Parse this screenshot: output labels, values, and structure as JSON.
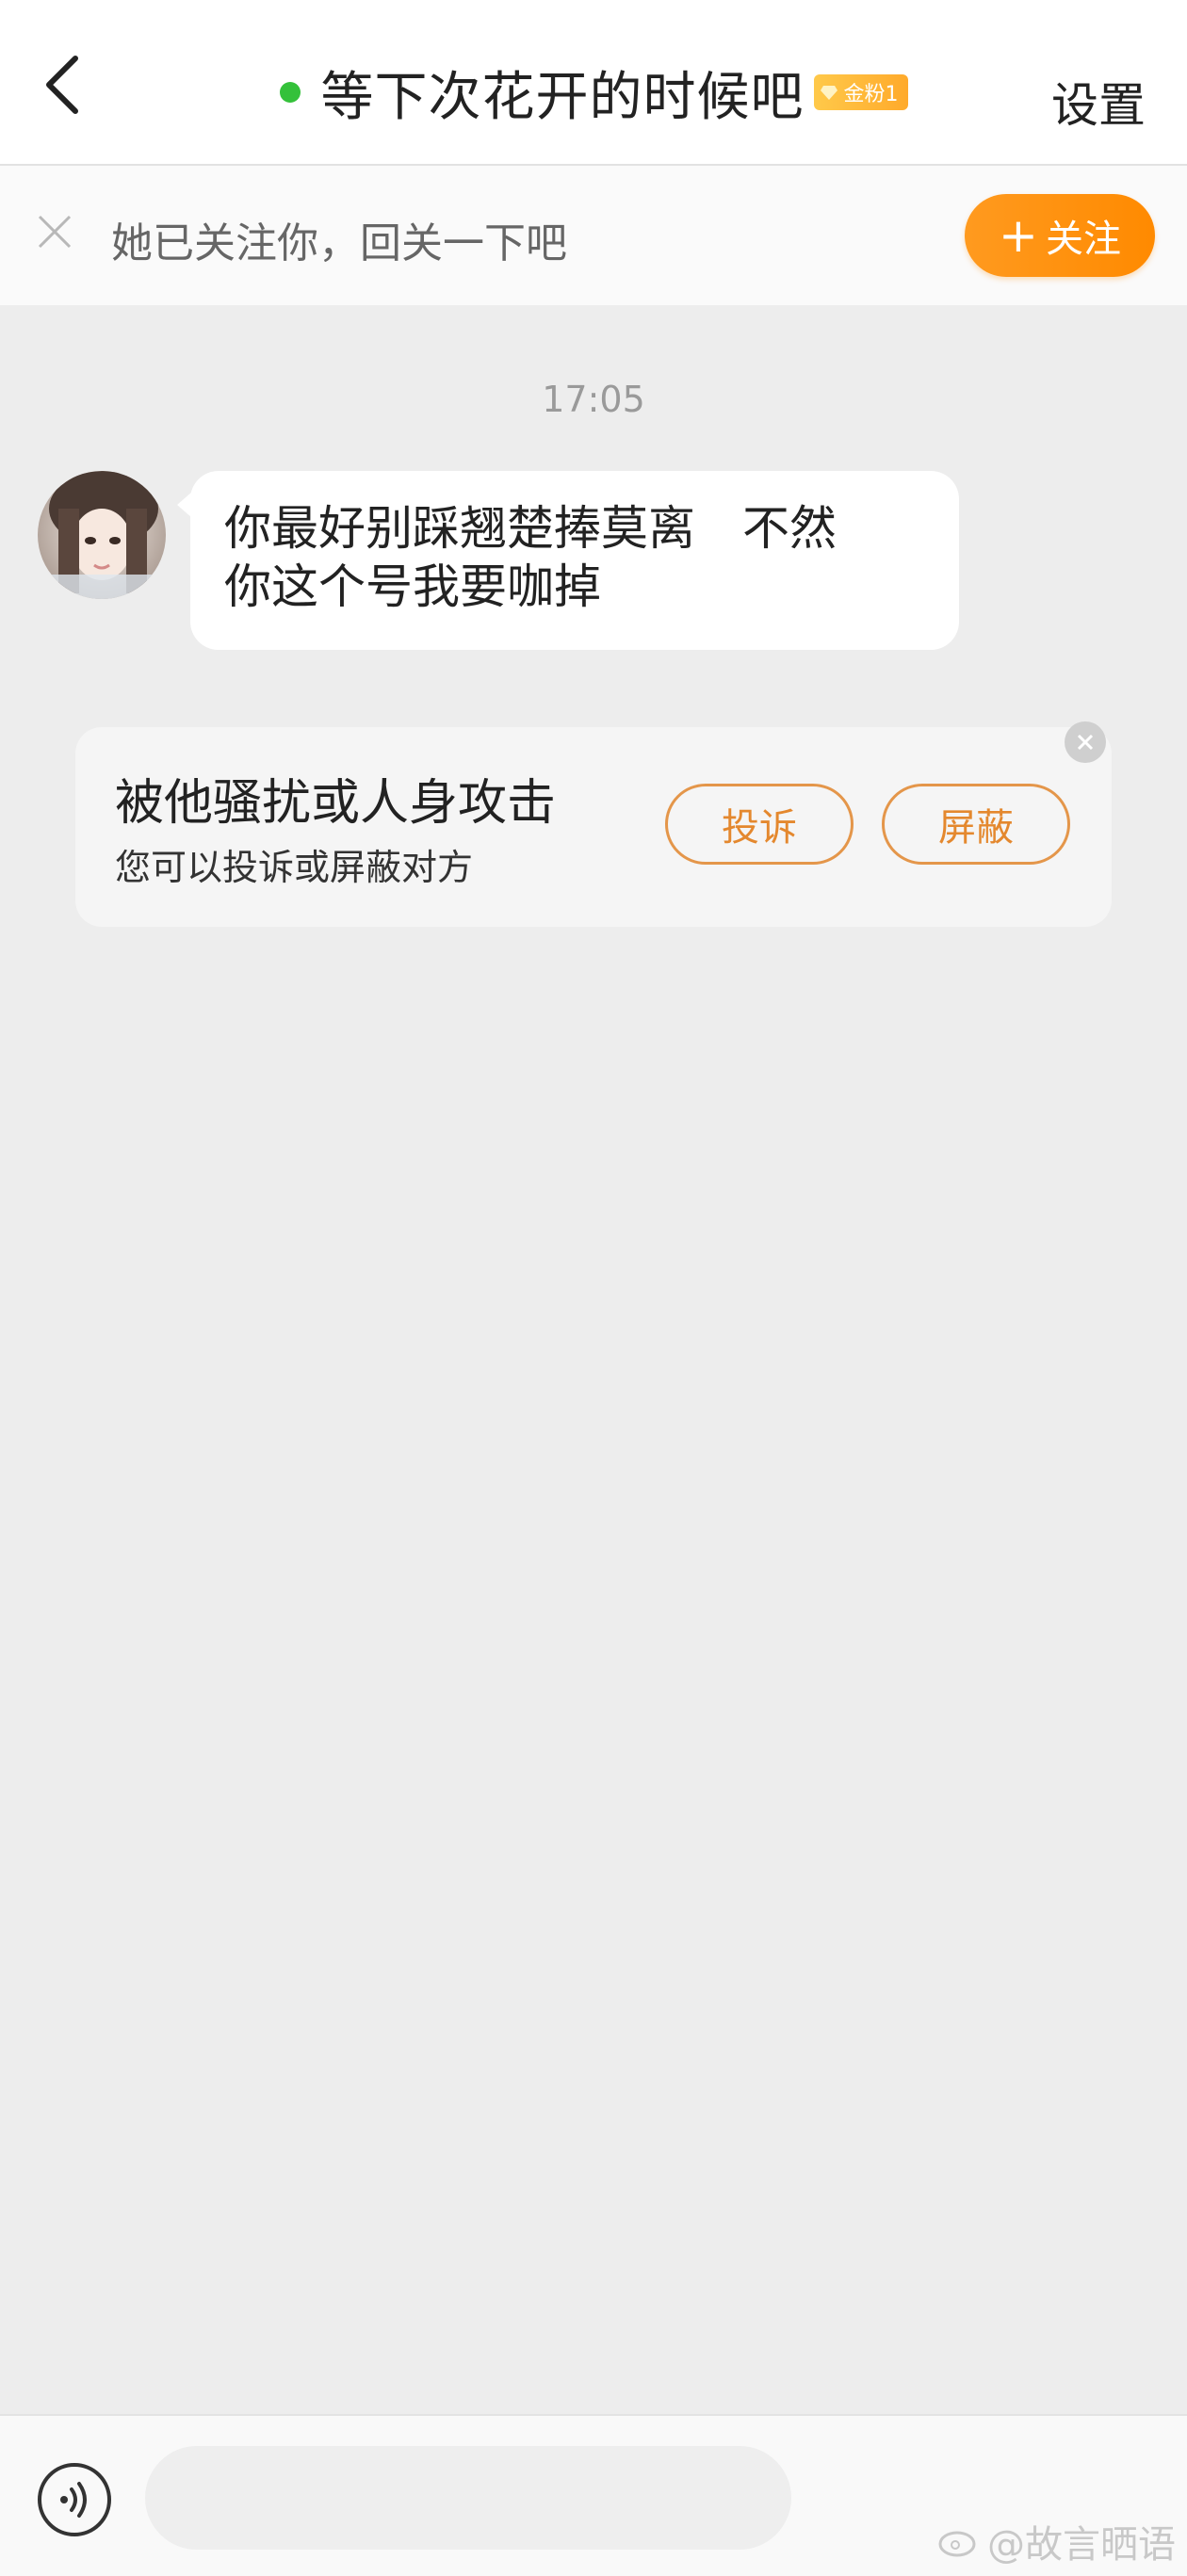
{
  "header": {
    "title": "等下次花开的时候吧",
    "fan_badge": "金粉1",
    "settings_label": "设置",
    "colors": {
      "online": "#34c13a",
      "badge": "#ffb032"
    }
  },
  "follow_banner": {
    "text": "她已关注你，回关一下吧",
    "button_label": "关注",
    "colors": {
      "button": "#ff8f10"
    }
  },
  "chat": {
    "timestamp": "17:05",
    "messages": [
      {
        "from": "other",
        "line1": "你最好别踩翘楚捧莫离　不然",
        "line2": "你这个号我要咖掉"
      }
    ]
  },
  "report_card": {
    "title": "被他骚扰或人身攻击",
    "subtitle": "您可以投诉或屏蔽对方",
    "complain_label": "投诉",
    "block_label": "屏蔽",
    "colors": {
      "button_border": "#e4964a"
    }
  },
  "composer": {
    "placeholder": ""
  },
  "watermark": {
    "text": "@故言晒语"
  },
  "icons": [
    "back-arrow-icon",
    "online-dot-icon",
    "gem-icon",
    "close-icon",
    "voice-icon",
    "weibo-icon"
  ]
}
